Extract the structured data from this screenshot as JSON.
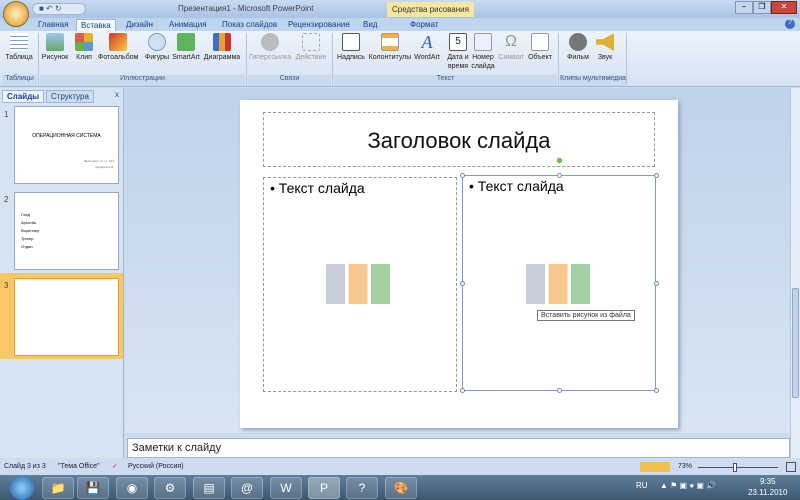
{
  "titlebar": {
    "title": "Презентация1 - Microsoft PowerPoint",
    "context_tab": "Средства рисования"
  },
  "tabs": [
    "Главная",
    "Вставка",
    "Дизайн",
    "Анимация",
    "Показ слайдов",
    "Рецензирование",
    "Вид",
    "Формат"
  ],
  "ribbon": {
    "buttons": [
      {
        "label": "Таблица",
        "disabled": false
      },
      {
        "label": "Рисунок"
      },
      {
        "label": "Клип"
      },
      {
        "label": "Фотоальбом"
      },
      {
        "label": "Фигуры"
      },
      {
        "label": "SmartArt"
      },
      {
        "label": "Диаграмма"
      },
      {
        "label": "Гиперссылка",
        "disabled": true
      },
      {
        "label": "Действие",
        "disabled": true
      },
      {
        "label": "Надпись"
      },
      {
        "label": "Колонтитулы"
      },
      {
        "label": "WordArt"
      },
      {
        "label": "Дата и время"
      },
      {
        "label": "Номер слайда"
      },
      {
        "label": "Символ",
        "disabled": true
      },
      {
        "label": "Объект"
      },
      {
        "label": "Фильм"
      },
      {
        "label": "Звук"
      }
    ],
    "groups": [
      "Таблицы",
      "Иллюстрации",
      "Связи",
      "Текст",
      "Клипы мультимедиа"
    ]
  },
  "left_panel": {
    "tabs": [
      "Слайды",
      "Структура"
    ],
    "close": "x",
    "slides": [
      {
        "num": "1",
        "title": "ОПЕРАЦИОННАЯ СИСТЕМА",
        "subtitle1": "Выполнил: ст. гр. 107",
        "subtitle2": "Сидоров А.Д."
      },
      {
        "num": "2",
        "bullets": [
          "Глад",
          "Apxoт6ь",
          "Buреллер",
          "Трогер",
          "Отдан"
        ]
      },
      {
        "num": "3"
      }
    ]
  },
  "slide": {
    "title": "Заголовок слайда",
    "left_text": "Текст слайда",
    "right_text": "Текст слайда",
    "tooltip": "Вставить рисунок из файла"
  },
  "notes": {
    "placeholder": "Заметки к слайду"
  },
  "status": {
    "slide": "Слайд 3 из 3",
    "theme": "\"Тема Office\"",
    "language": "Русский (Россия)",
    "zoom": "73%"
  },
  "taskbar": {
    "lang": "RU",
    "time": "9:35",
    "date": "23.11.2010"
  }
}
